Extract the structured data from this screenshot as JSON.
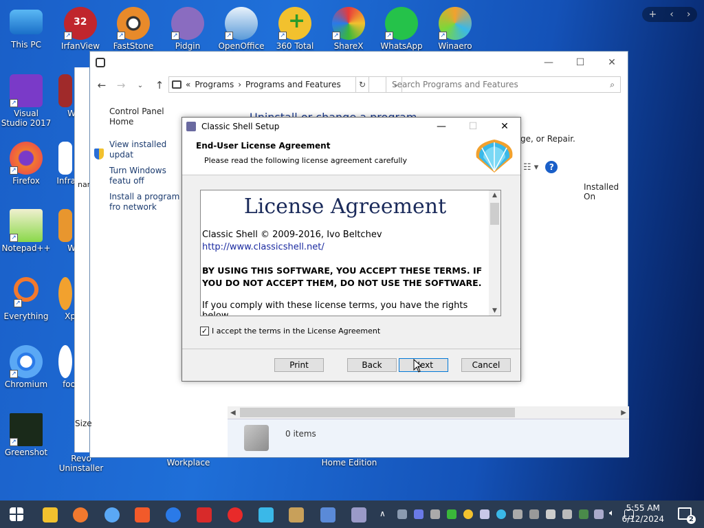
{
  "desktop": {
    "row1": [
      "This PC",
      "IrfanView",
      "FastStone",
      "Pidgin",
      "OpenOffice",
      "360 Total",
      "ShareX",
      "WhatsApp",
      "Winaero"
    ],
    "col1": [
      "Visual Studio 2017",
      "Firefox",
      "Notepad++",
      "Everything",
      "Chromium",
      "Greenshot"
    ],
    "col2": [
      "W",
      "Infra",
      "W",
      "Xp",
      "foo",
      "Revo Uninstaller"
    ],
    "irfan_badge": "32",
    "bottom_labels": [
      "Workplace",
      "Home Edition"
    ]
  },
  "explorer": {
    "breadcrumb_prefix": "«",
    "breadcrumb": [
      "Programs",
      "Programs and Features"
    ],
    "search_placeholder": "Search Programs and Features",
    "sidebar": [
      "Control Panel Home",
      "View installed updat",
      "Turn Windows featu off",
      "Install a program fro network"
    ],
    "heading": "Uninstall or change a program",
    "desc": "ge, or Repair.",
    "column": "Installed On",
    "status": "0 items",
    "back_text": "nar",
    "size_text": "Size"
  },
  "dialog": {
    "title": "Classic Shell Setup",
    "header_title": "End-User License Agreement",
    "header_sub": "Please read the following license agreement carefully",
    "license": {
      "title": "License Agreement",
      "copyright": "Classic Shell © 2009-2016, Ivo Beltchev",
      "url": "http://www.classicshell.net/",
      "terms": "BY USING THIS SOFTWARE, YOU ACCEPT THESE TERMS. IF YOU DO NOT ACCEPT THEM, DO NOT USE THE SOFTWARE.",
      "more": "If you comply with these license terms, you have the rights below."
    },
    "accept_label": "I accept the terms in the License Agreement",
    "accept_checked": "✓",
    "buttons": {
      "print": "Print",
      "back": "Back",
      "next": "Next",
      "cancel": "Cancel"
    }
  },
  "taskbar": {
    "time": "5:55 AM",
    "date": "6/12/2024",
    "notifications": "2"
  }
}
